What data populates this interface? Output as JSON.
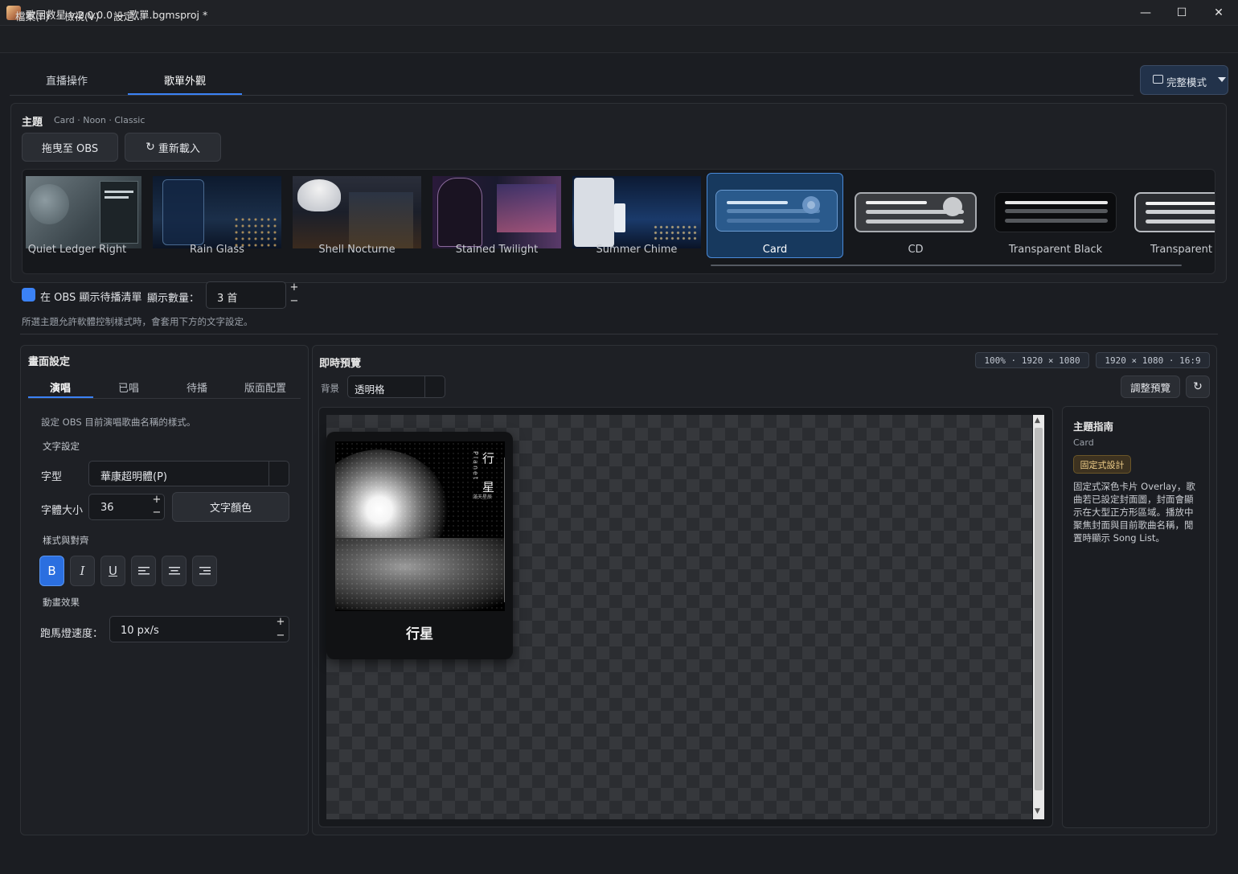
{
  "window": {
    "title": "歌回救星  v.2.0.0.0  —  歌單.bgmsproj  *",
    "minimize": "—",
    "maximize": "☐",
    "close": "✕"
  },
  "menu": [
    "檔案(F)",
    "檢視(V)",
    "設定..."
  ],
  "main_tabs": [
    {
      "label": "直播操作",
      "active": false
    },
    {
      "label": "歌單外觀",
      "active": true
    }
  ],
  "mode_button": {
    "label": "完整模式",
    "icon": "layout-icon"
  },
  "theme": {
    "heading": "主題",
    "subtitle": "Card · Noon · Classic",
    "drag_button": "拖曳至 OBS",
    "reload_button": "重新載入",
    "items": [
      {
        "label": "Quiet Ledger Right"
      },
      {
        "label": "Rain Glass"
      },
      {
        "label": "Shell Nocturne"
      },
      {
        "label": "Stained Twilight"
      },
      {
        "label": "Summer Chime"
      },
      {
        "label": "Card",
        "selected": true
      },
      {
        "label": "CD"
      },
      {
        "label": "Transparent Black"
      },
      {
        "label": "Transparent W"
      }
    ]
  },
  "queue": {
    "checkbox_label": "在 OBS 顯示待播清單",
    "checked": true,
    "count_label": "顯示數量：",
    "count_value": "3 首",
    "plus": "+",
    "minus": "−"
  },
  "note": "所選主題允許軟體控制樣式時，會套用下方的文字設定。",
  "screen_settings": {
    "title": "畫面設定",
    "tabs": [
      "演唱",
      "已唱",
      "待播",
      "版面配置"
    ],
    "description": "設定 OBS 目前演唱歌曲名稱的樣式。",
    "text_section": "文字設定",
    "font_label": "字型",
    "font_value": "華康超明體(P)",
    "size_label": "字體大小",
    "size_value": "36",
    "color_button": "文字顏色",
    "style_section": "樣式與對齊",
    "format_buttons": [
      "B",
      "I",
      "U"
    ],
    "anim_section": "動畫效果",
    "marquee_label": "跑馬燈速度：",
    "marquee_value": "10 px/s"
  },
  "preview": {
    "title": "即時預覽",
    "badge_zoom": "100%  ·  1920 × 1080",
    "badge_res": "1920 × 1080  ·  16:9",
    "bg_label": "背景",
    "bg_value": "透明格",
    "adjust_button": "調整預覽",
    "card_title": "行星",
    "cover_title_1": "行",
    "cover_title_2": "星",
    "cover_vertical": "Planet",
    "cover_artist": "滿天星辰"
  },
  "guide": {
    "title": "主題指南",
    "name": "Card",
    "badge": "固定式設計",
    "description": "固定式深色卡片 Overlay，歌曲若已設定封面圖，封面會顯示在大型正方形區域。播放中聚焦封面與目前歌曲名稱，閒置時顯示 Song List。"
  },
  "colors": {
    "accent": "#3b82f6",
    "background": "#1b1d22",
    "panel": "#1e2025",
    "badge": "#f0cf8a"
  }
}
